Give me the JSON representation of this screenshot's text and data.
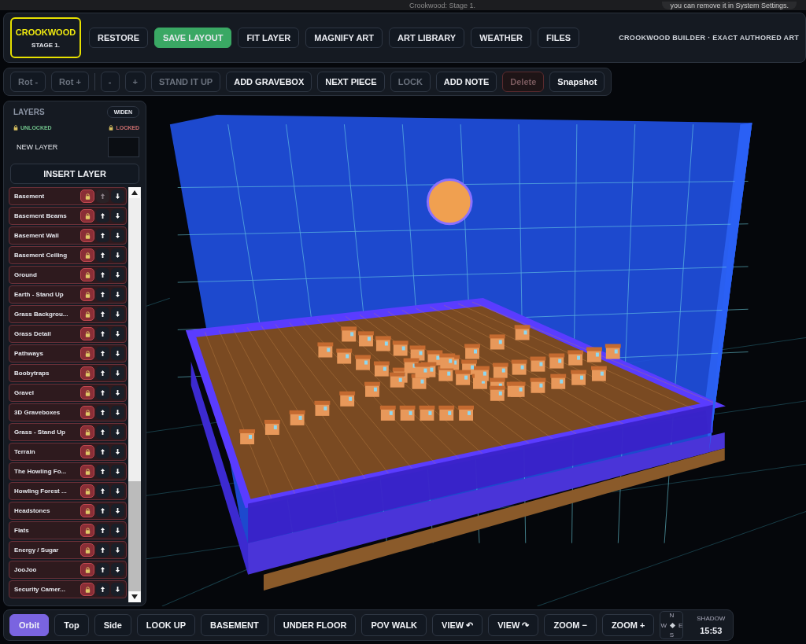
{
  "system_bar": {
    "title": "Crookwood: Stage 1.",
    "notice": "you can remove it in System Settings."
  },
  "header": {
    "logo": {
      "title": "CROOKWOOD",
      "subtitle": "STAGE 1."
    },
    "buttons": [
      {
        "label": "RESTORE",
        "kind": "normal"
      },
      {
        "label": "SAVE LAYOUT",
        "kind": "primary"
      },
      {
        "label": "FIT LAYER",
        "kind": "normal"
      },
      {
        "label": "MAGNIFY ART",
        "kind": "normal"
      },
      {
        "label": "ART LIBRARY",
        "kind": "normal"
      },
      {
        "label": "WEATHER",
        "kind": "normal"
      },
      {
        "label": "FILES",
        "kind": "normal"
      }
    ],
    "caption": "CROOKWOOD BUILDER · EXACT AUTHORED ART"
  },
  "toolbar": [
    {
      "label": "Rot -",
      "kind": "normal",
      "disabled": true
    },
    {
      "label": "Rot +",
      "kind": "normal",
      "disabled": true
    },
    {
      "label": "-",
      "kind": "normal",
      "disabled": true
    },
    {
      "label": "+",
      "kind": "normal",
      "disabled": true
    },
    {
      "label": "STAND IT UP",
      "kind": "normal",
      "disabled": true
    },
    {
      "label": "ADD GRAVEBOX",
      "kind": "normal",
      "disabled": false
    },
    {
      "label": "NEXT PIECE",
      "kind": "normal",
      "disabled": false
    },
    {
      "label": "LOCK",
      "kind": "normal",
      "disabled": true
    },
    {
      "label": "ADD NOTE",
      "kind": "normal",
      "disabled": false
    },
    {
      "label": "Delete",
      "kind": "danger",
      "disabled": true
    },
    {
      "label": "Snapshot",
      "kind": "normal",
      "disabled": false
    }
  ],
  "layers_panel": {
    "title": "LAYERS",
    "widen": "WIDEN",
    "legend_unlocked": "UNLOCKED",
    "legend_locked": "LOCKED",
    "new_layer_label": "NEW LAYER",
    "insert": "INSERT LAYER",
    "layers": [
      {
        "name": "Basement",
        "locked": true
      },
      {
        "name": "Basement Beams",
        "locked": true
      },
      {
        "name": "Basement Wall",
        "locked": true
      },
      {
        "name": "Basement Ceiling",
        "locked": true
      },
      {
        "name": "Ground",
        "locked": true
      },
      {
        "name": "Earth - Stand Up",
        "locked": true
      },
      {
        "name": "Grass Backgrou...",
        "locked": true
      },
      {
        "name": "Grass Detail",
        "locked": true
      },
      {
        "name": "Pathways",
        "locked": true
      },
      {
        "name": "Boobytraps",
        "locked": true
      },
      {
        "name": "Gravel",
        "locked": true
      },
      {
        "name": "3D Graveboxes",
        "locked": true
      },
      {
        "name": "Grass - Stand Up",
        "locked": true
      },
      {
        "name": "Terrain",
        "locked": true
      },
      {
        "name": "The Howling Fo...",
        "locked": true
      },
      {
        "name": "Howling Forest ...",
        "locked": true
      },
      {
        "name": "Headstones",
        "locked": true
      },
      {
        "name": "Flats",
        "locked": true
      },
      {
        "name": "Energy / Sugar",
        "locked": true
      },
      {
        "name": "JooJoo",
        "locked": true
      },
      {
        "name": "Security Camer...",
        "locked": true
      }
    ]
  },
  "view_bar": {
    "buttons": [
      {
        "label": "Orbit",
        "selected": true
      },
      {
        "label": "Top",
        "selected": false
      },
      {
        "label": "Side",
        "selected": false
      },
      {
        "label": "LOOK UP",
        "selected": false
      },
      {
        "label": "BASEMENT",
        "selected": false
      },
      {
        "label": "UNDER FLOOR",
        "selected": false
      },
      {
        "label": "POV WALK",
        "selected": false
      },
      {
        "label": "VIEW ↶",
        "selected": false
      },
      {
        "label": "VIEW ↷",
        "selected": false
      },
      {
        "label": "ZOOM −",
        "selected": false
      },
      {
        "label": "ZOOM +",
        "selected": false
      }
    ],
    "compass": {
      "n": "N",
      "w": "W",
      "e": "E",
      "s": "S"
    },
    "shadow": {
      "label": "SHADOW",
      "time": "15:53"
    }
  }
}
